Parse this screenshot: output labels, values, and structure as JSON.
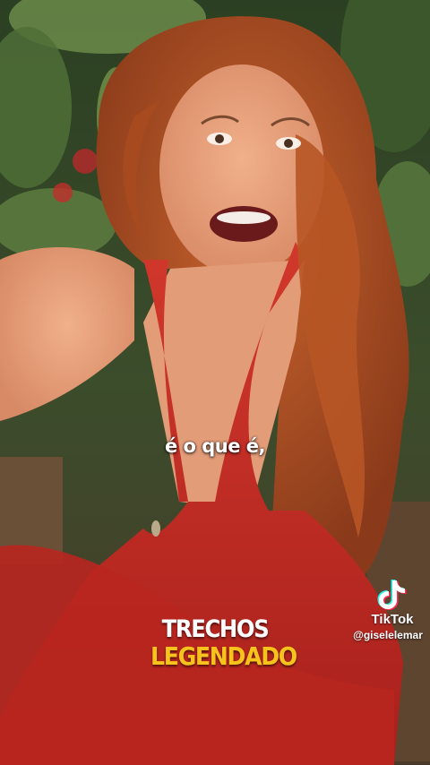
{
  "video": {
    "subtitle": "é o que é,",
    "badge": {
      "line1": "TRECHOS",
      "line2": "LEGENDADO",
      "line2_color": "#f5c31c"
    }
  },
  "watermark": {
    "brand": "TikTok",
    "username": "@giselelemar",
    "logo_icon": "tiktok-note-icon"
  }
}
